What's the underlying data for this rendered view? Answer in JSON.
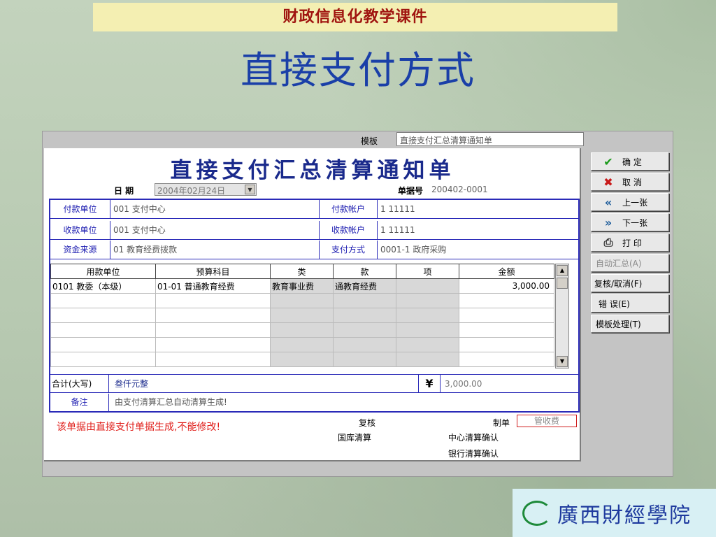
{
  "slide": {
    "course_title": "财政信息化教学课件",
    "title": "直接支付方式",
    "college": "廣西財經學院"
  },
  "form": {
    "template_label": "模板",
    "template_value": "直接支付汇总清算通知单",
    "title": "直接支付汇总清算通知单",
    "date_label": "日  期",
    "date_value": "2004年02月24日",
    "doc_no_label": "单据号",
    "doc_no_value": "200402-0001",
    "payer_label": "付款单位",
    "payer_value": "001  支付中心",
    "payer_acct_label": "付款帐户",
    "payer_acct_value": "1  11111",
    "payee_label": "收款单位",
    "payee_value": "001  支付中心",
    "payee_acct_label": "收款帐户",
    "payee_acct_value": "1  11111",
    "fund_label": "资金来源",
    "fund_value": "01  教育经费拨款",
    "pay_method_label": "支付方式",
    "pay_method_value": "0001-1  政府采购",
    "table": {
      "columns": [
        "用款单位",
        "预算科目",
        "类",
        "款",
        "项",
        "金额"
      ],
      "rows": [
        [
          "0101  教委（本级）",
          "01-01  普通教育经费",
          "教育事业费",
          "通教育经费",
          "",
          "3,000.00"
        ]
      ]
    },
    "total_label": "合计(大写)",
    "total_words": "叁仟元整",
    "currency_symbol": "¥",
    "total_amount": "3,000.00",
    "remark_label": "备注",
    "remark_value": "由支付清算汇总自动清算生成!",
    "warning": "该单据由直接支付单据生成,不能修改!",
    "review_label": "复核",
    "treasury_label": "国库清算",
    "maker_label": "制单",
    "maker_value": "管收费",
    "center_confirm_label": "中心清算确认",
    "bank_confirm_label": "银行清算确认"
  },
  "buttons": {
    "ok": "确 定",
    "cancel": "取 消",
    "prev": "上一张",
    "next": "下一张",
    "print": "打 印",
    "auto_sum": "自动汇总(A)",
    "review_cancel": "复核/取消(F)",
    "error": "错  误(E)",
    "template_proc": "模板处理(T)"
  },
  "icons": {
    "ok": "check-icon",
    "cancel": "x-icon",
    "prev": "double-left-icon",
    "next": "double-right-icon",
    "print": "printer-icon"
  }
}
